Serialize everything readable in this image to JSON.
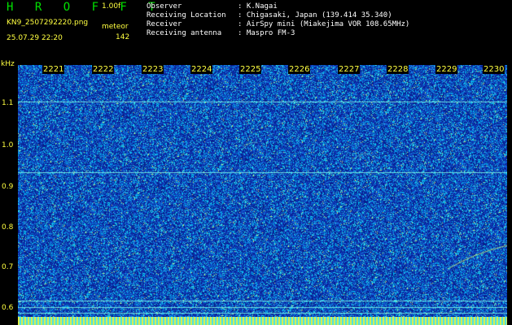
{
  "header": {
    "title": "H R O F F T",
    "version": "1.00f",
    "filename": "KN9_2507292220.png",
    "meteor_label": "meteor",
    "datetime": "25.07.29 22:20",
    "meteor_count": "142",
    "info": [
      {
        "key": "Observer",
        "value": ": K.Nagai"
      },
      {
        "key": "Receiving Location",
        "value": ": Chigasaki, Japan (139.414 35.340)"
      },
      {
        "key": "Receiver",
        "value": ": AirSpy mini (Miakejima VOR 108.65MHz)"
      },
      {
        "key": "Receiving antenna",
        "value": ": Maspro FM-3"
      }
    ]
  },
  "axis": {
    "unit": "kHz",
    "frequency_ticks": [
      "1.1",
      "1.0",
      "0.9",
      "0.8",
      "0.7",
      "0.6"
    ],
    "time_labels": [
      "2221",
      "2222",
      "2223",
      "2224",
      "2225",
      "2226",
      "2227",
      "2228",
      "2229",
      "2230"
    ]
  },
  "colors": {
    "background": "#000000",
    "plot": "#0a2fa8",
    "label": "#ffff40",
    "title": "#00e000",
    "info": "#ffffff",
    "noise": "#00c8ff",
    "timebar_a": "#e8f040",
    "timebar_b": "#40e0f0"
  }
}
